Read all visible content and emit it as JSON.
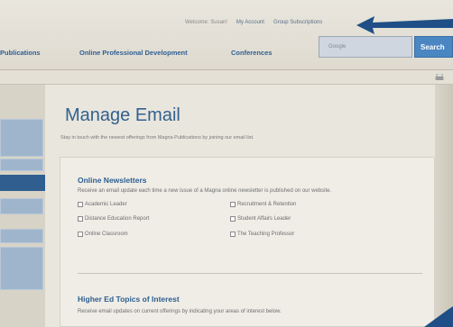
{
  "header": {
    "welcome": "Welcome: Susan!",
    "my_account": "My Account",
    "group_subscriptions": "Group Subscriptions"
  },
  "nav": {
    "items": [
      {
        "label": "Publications"
      },
      {
        "label": "Online Professional Development"
      },
      {
        "label": "Conferences"
      }
    ],
    "search_placeholder": "Google",
    "search_button": "Search"
  },
  "page": {
    "title": "Manage Email",
    "intro": "Stay in touch with the newest offerings from Magna Publications by joining our email list."
  },
  "newsletters": {
    "title": "Online Newsletters",
    "description": "Receive an email update each time a new issue of a Magna online newsletter is published on our website.",
    "options": [
      {
        "label": "Academic Leader"
      },
      {
        "label": "Recruitment & Retention"
      },
      {
        "label": "Distance Education Report"
      },
      {
        "label": "Student Affairs Leader"
      },
      {
        "label": "Online Classroom"
      },
      {
        "label": "The Teaching Professor"
      }
    ]
  },
  "topics": {
    "title": "Higher Ed Topics of Interest",
    "description": "Receive email updates on current offerings by indicating your areas of interest below."
  },
  "colors": {
    "accent": "#2f5f93",
    "search_button": "#4a86c2",
    "arrow": "#1f4f86"
  }
}
